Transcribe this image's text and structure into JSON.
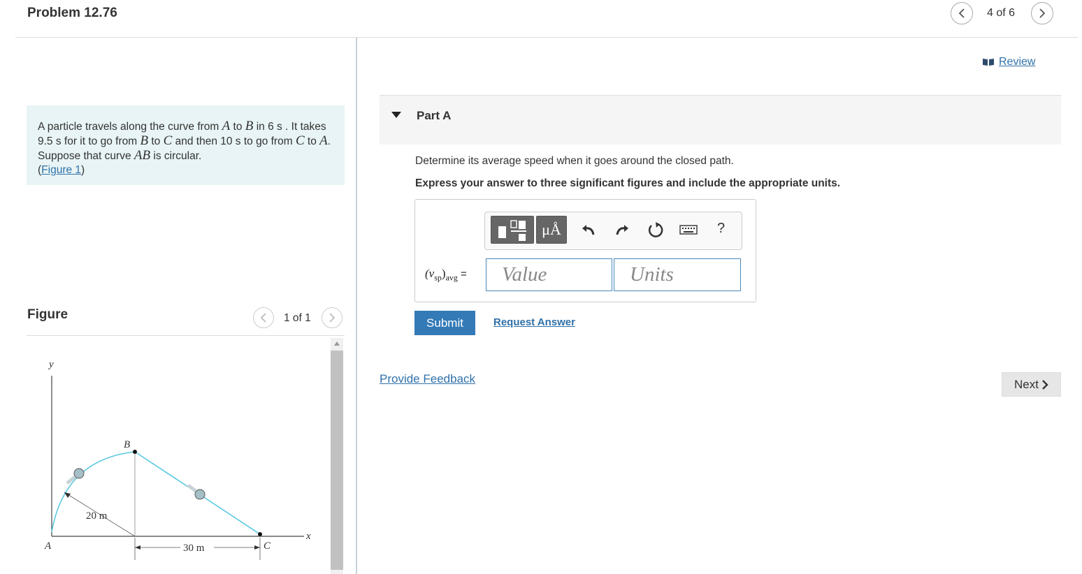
{
  "header": {
    "title": "Problem 12.76",
    "pager": "4 of 6"
  },
  "problem": {
    "text_1": "A particle travels along the curve from ",
    "A": "A",
    "text_2": " to ",
    "B": "B",
    "text_3": " in 6  s . It takes 9.5  s for it to go from ",
    "B2": "B",
    "text_4": " to ",
    "C": "C",
    "text_5": " and then 10 s to go from ",
    "C2": "C",
    "text_6": " to ",
    "A2": "A",
    "text_7": ". Suppose that curve ",
    "AB": "AB",
    "text_8": " is circular.",
    "figure_link_open": "(",
    "figure_link": "Figure 1",
    "figure_link_close": ")"
  },
  "figure": {
    "title": "Figure",
    "pager": "1 of 1",
    "labels": {
      "y": "y",
      "x": "x",
      "A": "A",
      "B": "B",
      "C": "C",
      "radius": "20 m",
      "width": "30 m"
    }
  },
  "review": {
    "label": "Review"
  },
  "part": {
    "title": "Part A",
    "question": "Determine its average speed when it goes around the closed path.",
    "instructions": "Express your answer to three significant figures and include the appropriate units.",
    "var_main": "(v",
    "var_sub": "sp",
    "var_close": ")",
    "var_sub2": "avg",
    "var_eq": " =",
    "value_placeholder": "Value",
    "units_placeholder": "Units",
    "unit_button": "μÅ",
    "help": "?"
  },
  "actions": {
    "submit": "Submit",
    "request_answer": "Request Answer",
    "feedback": "Provide Feedback",
    "next": "Next"
  },
  "colors": {
    "accent": "#337ab7",
    "link": "#3071a9",
    "info_bg": "#e8f4f5",
    "curve": "#5bc8e0"
  }
}
